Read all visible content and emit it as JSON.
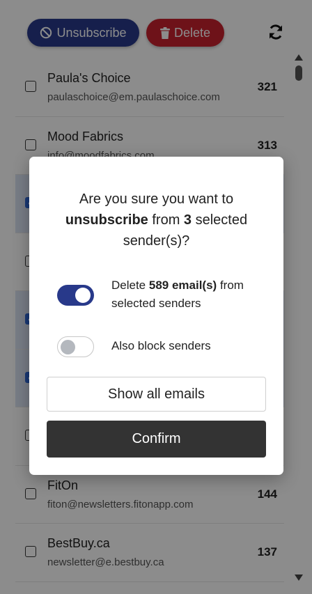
{
  "toolbar": {
    "unsubscribe_label": "Unsubscribe",
    "delete_label": "Delete",
    "unsubscribe_color": "#28398a",
    "delete_color": "#c8212f"
  },
  "senders": [
    {
      "name": "Paula's Choice",
      "email": "paulaschoice@em.paulaschoice.com",
      "count": "321",
      "selected": false
    },
    {
      "name": "Mood Fabrics",
      "email": "info@moodfabrics.com",
      "count": "313",
      "selected": false
    },
    {
      "name": "",
      "email": "",
      "count": "",
      "selected": true
    },
    {
      "name": "",
      "email": "",
      "count": "",
      "selected": false
    },
    {
      "name": "",
      "email": "",
      "count": "",
      "selected": true
    },
    {
      "name": "",
      "email": "",
      "count": "",
      "selected": true
    },
    {
      "name": "",
      "email": "",
      "count": "",
      "selected": false
    },
    {
      "name": "FitOn",
      "email": "fiton@newsletters.fitonapp.com",
      "count": "144",
      "selected": false
    },
    {
      "name": "BestBuy.ca",
      "email": "newsletter@e.bestbuy.ca",
      "count": "137",
      "selected": false
    }
  ],
  "modal": {
    "question_pre": "Are you sure you want to",
    "question_action": "unsubscribe",
    "question_mid": "from",
    "question_count": "3",
    "question_post": "selected sender(s)?",
    "delete_option_pre": "Delete",
    "delete_option_bold": "589 email(s)",
    "delete_option_post": "from selected senders",
    "delete_option_on": true,
    "block_option": "Also block senders",
    "block_option_on": false,
    "show_all_label": "Show all emails",
    "confirm_label": "Confirm"
  }
}
